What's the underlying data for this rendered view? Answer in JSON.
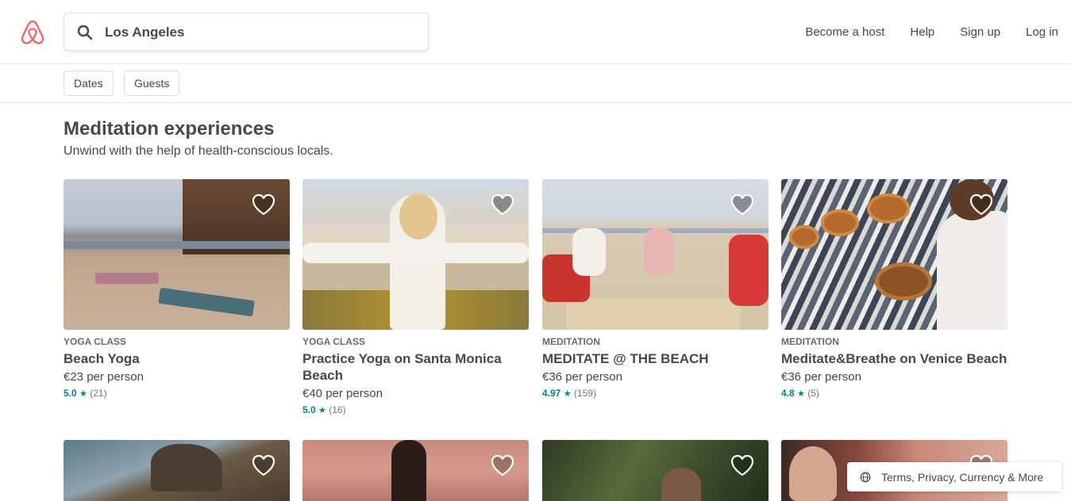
{
  "search": {
    "value": "Los Angeles"
  },
  "nav": {
    "become_host": "Become a host",
    "help": "Help",
    "sign_up": "Sign up",
    "log_in": "Log in"
  },
  "filters": {
    "dates": "Dates",
    "guests": "Guests"
  },
  "section": {
    "title": "Meditation experiences",
    "subtitle": "Unwind with the help of health-conscious locals."
  },
  "cards": [
    {
      "kind": "YOGA CLASS",
      "name": "Beach Yoga",
      "price": "€23 per person",
      "rating": "5.0",
      "count": "(21)"
    },
    {
      "kind": "YOGA CLASS",
      "name": "Practice Yoga on Santa Monica Beach",
      "price": "€40 per person",
      "rating": "5.0",
      "count": "(16)"
    },
    {
      "kind": "MEDITATION",
      "name": "MEDITATE @ THE BEACH",
      "price": "€36 per person",
      "rating": "4.97",
      "count": "(159)"
    },
    {
      "kind": "MEDITATION",
      "name": "Meditate&Breathe on Venice Beach",
      "price": "€36 per person",
      "rating": "4.8",
      "count": "(5)"
    }
  ],
  "footer": {
    "label": "Terms, Privacy, Currency & More"
  },
  "icons": {
    "logo": "airbnb-logo-icon",
    "search": "search-icon",
    "heart": "heart-icon",
    "star": "star-icon",
    "globe": "globe-icon"
  },
  "colors": {
    "brand": "#ff5a5f",
    "rating": "#008489",
    "text": "#484848"
  }
}
